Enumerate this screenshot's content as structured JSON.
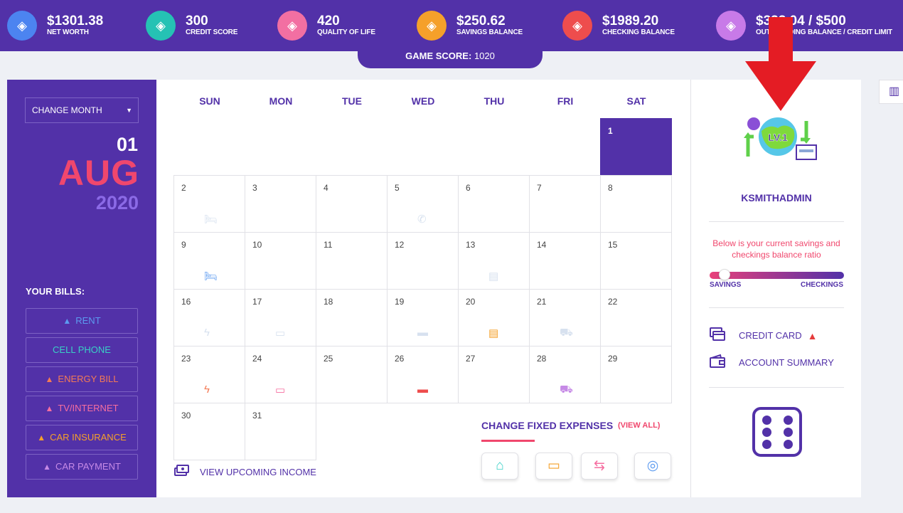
{
  "colors": {
    "brand_purple": "#5231a8",
    "accent_pink": "#f0476d",
    "warning_red": "#e53b3b"
  },
  "stats": [
    {
      "value": "$1301.38",
      "label": "NET WORTH",
      "icon": "wallet-icon",
      "color": "#4c84f0"
    },
    {
      "value": "300",
      "label": "CREDIT SCORE",
      "icon": "gauge-icon",
      "color": "#25c2b4"
    },
    {
      "value": "420",
      "label": "QUALITY OF LIFE",
      "icon": "star-icon",
      "color": "#f26fa2"
    },
    {
      "value": "$250.62",
      "label": "SAVINGS BALANCE",
      "icon": "coins-icon",
      "color": "#f5a02a"
    },
    {
      "value": "$1989.20",
      "label": "CHECKING BALANCE",
      "icon": "cash-icon",
      "color": "#ee4d4d"
    },
    {
      "value": "$333.04 / $500",
      "label": "OUTSTANDING BALANCE / CREDIT LIMIT",
      "icon": "credit-wallet-icon",
      "color": "#c87ae8"
    }
  ],
  "game_score": {
    "label": "GAME SCORE:",
    "value": "1020"
  },
  "left": {
    "month_select": "CHANGE MONTH",
    "day": "01",
    "month": "AUG",
    "year": "2020",
    "bills_title": "YOUR BILLS:",
    "bills": [
      {
        "label": "RENT",
        "warn": true,
        "color": "#5c9bf0"
      },
      {
        "label": "CELL PHONE",
        "warn": false,
        "color": "#39d0c6"
      },
      {
        "label": "ENERGY BILL",
        "warn": true,
        "color": "#f47a55"
      },
      {
        "label": "TV/INTERNET",
        "warn": true,
        "color": "#f66ea0"
      },
      {
        "label": "CAR INSURANCE",
        "warn": true,
        "color": "#f5a02a"
      },
      {
        "label": "CAR PAYMENT",
        "warn": true,
        "color": "#c68ae6"
      }
    ]
  },
  "calendar": {
    "weekdays": [
      "SUN",
      "MON",
      "TUE",
      "WED",
      "THU",
      "FRI",
      "SAT"
    ],
    "selected_day": 1,
    "days": [
      {
        "d": "1",
        "col": 6,
        "row": 0
      },
      {
        "d": "2",
        "col": 0,
        "row": 1,
        "icon": "bed-icon",
        "glyph": "🛏",
        "color": "#d7e1ef"
      },
      {
        "d": "3",
        "col": 1,
        "row": 1
      },
      {
        "d": "4",
        "col": 2,
        "row": 1
      },
      {
        "d": "5",
        "col": 3,
        "row": 1,
        "icon": "phone-icon",
        "glyph": "✆",
        "color": "#d7e1ef"
      },
      {
        "d": "6",
        "col": 4,
        "row": 1
      },
      {
        "d": "7",
        "col": 5,
        "row": 1
      },
      {
        "d": "8",
        "col": 6,
        "row": 1
      },
      {
        "d": "9",
        "col": 0,
        "row": 2,
        "icon": "bed-icon",
        "glyph": "🛏",
        "color": "#5c9bf0"
      },
      {
        "d": "10",
        "col": 1,
        "row": 2
      },
      {
        "d": "11",
        "col": 2,
        "row": 2
      },
      {
        "d": "12",
        "col": 3,
        "row": 2
      },
      {
        "d": "13",
        "col": 4,
        "row": 2,
        "icon": "id-card-icon",
        "glyph": "▤",
        "color": "#d7e1ef"
      },
      {
        "d": "14",
        "col": 5,
        "row": 2
      },
      {
        "d": "15",
        "col": 6,
        "row": 2
      },
      {
        "d": "16",
        "col": 0,
        "row": 3,
        "icon": "lightning-icon",
        "glyph": "ϟ",
        "color": "#d7e1ef"
      },
      {
        "d": "17",
        "col": 1,
        "row": 3,
        "icon": "monitor-icon",
        "glyph": "▭",
        "color": "#d7e1ef"
      },
      {
        "d": "18",
        "col": 2,
        "row": 3
      },
      {
        "d": "19",
        "col": 3,
        "row": 3,
        "icon": "credit-card-icon",
        "glyph": "▬",
        "color": "#d7e1ef"
      },
      {
        "d": "20",
        "col": 4,
        "row": 3,
        "icon": "id-card-icon",
        "glyph": "▤",
        "color": "#f5a02a"
      },
      {
        "d": "21",
        "col": 5,
        "row": 3,
        "icon": "car-icon",
        "glyph": "⛟",
        "color": "#d7e1ef"
      },
      {
        "d": "22",
        "col": 6,
        "row": 3
      },
      {
        "d": "23",
        "col": 0,
        "row": 4,
        "icon": "lightning-icon",
        "glyph": "ϟ",
        "color": "#f47a55"
      },
      {
        "d": "24",
        "col": 1,
        "row": 4,
        "icon": "monitor-icon",
        "glyph": "▭",
        "color": "#f66ea0"
      },
      {
        "d": "25",
        "col": 2,
        "row": 4
      },
      {
        "d": "26",
        "col": 3,
        "row": 4,
        "icon": "credit-card-icon",
        "glyph": "▬",
        "color": "#ee4d4d"
      },
      {
        "d": "27",
        "col": 4,
        "row": 4
      },
      {
        "d": "28",
        "col": 5,
        "row": 4,
        "icon": "car-icon",
        "glyph": "⛟",
        "color": "#c68ae6"
      },
      {
        "d": "29",
        "col": 6,
        "row": 4
      },
      {
        "d": "30",
        "col": 0,
        "row": 5
      },
      {
        "d": "31",
        "col": 1,
        "row": 5
      }
    ],
    "upcoming_income": "VIEW UPCOMING INCOME",
    "fixed_expenses_title": "CHANGE FIXED EXPENSES",
    "view_all": "(VIEW ALL)",
    "fixed_expense_buttons": [
      {
        "icon": "house-icon",
        "glyph": "⌂",
        "color": "#39d0c6"
      },
      {
        "icon": "tv-icon",
        "glyph": "▭",
        "color": "#f5a02a"
      },
      {
        "icon": "phone-transfer-icon",
        "glyph": "⇆",
        "color": "#f66ea0"
      },
      {
        "icon": "coin-stack-icon",
        "glyph": "◎",
        "color": "#5c9bf0"
      }
    ]
  },
  "right": {
    "level_text": "LV.1",
    "username": "KSMITHADMIN",
    "ratio_text": "Below is your current savings and checkings balance ratio",
    "ratio_savings_fraction": 0.11,
    "ratio_left_label": "SAVINGS",
    "ratio_right_label": "CHECKINGS",
    "links": [
      {
        "label": "CREDIT CARD",
        "icon": "card-stack-icon",
        "warn": true
      },
      {
        "label": "ACCOUNT SUMMARY",
        "icon": "wallet-icon",
        "warn": false
      }
    ]
  }
}
